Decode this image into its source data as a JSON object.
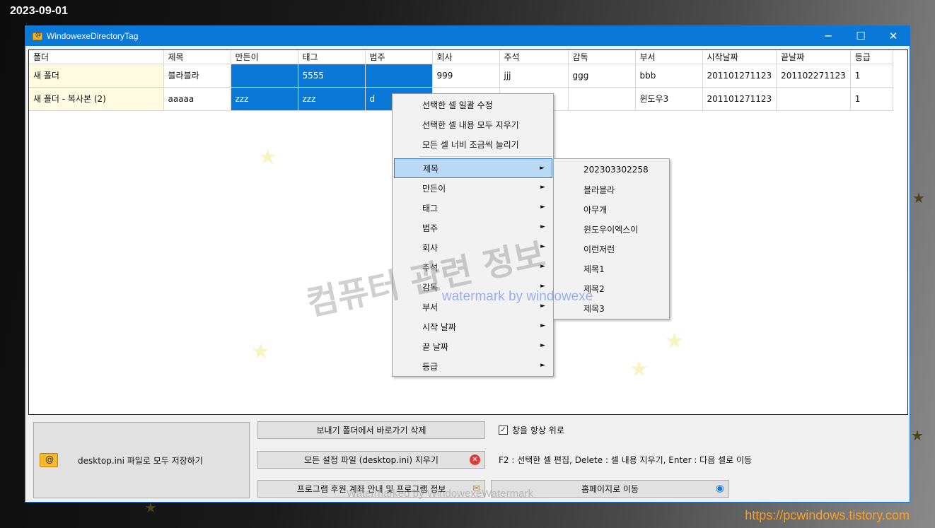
{
  "overlay": {
    "date": "2023-09-01",
    "site_url": "https://pcwindows.tistory.com",
    "watermark_korean": "컴퓨터 관련 정보",
    "watermark_english": "watermark by windowexe",
    "watermark_bottom": "Watermarked by WindowexeWatermark"
  },
  "window": {
    "title": "WindowexeDirectoryTag",
    "minimize": "─",
    "maximize": "☐",
    "close": "✕"
  },
  "grid": {
    "columns": [
      "폴더",
      "제목",
      "만든이",
      "태그",
      "범주",
      "회사",
      "주석",
      "감독",
      "부서",
      "시작날짜",
      "끝날짜",
      "등급"
    ],
    "rows": [
      [
        "새 폴더",
        "블라블라",
        "",
        "5555",
        "",
        "999",
        "jjj",
        "ggg",
        "bbb",
        "201101271123",
        "201102271123",
        "1"
      ],
      [
        "새 폴더 - 복사본 (2)",
        "aaaaa",
        "zzz",
        "zzz",
        "d",
        "",
        "",
        "",
        "윈도우3",
        "201101271123",
        "",
        "1"
      ]
    ]
  },
  "context_menu": {
    "top_items": [
      "선택한 셀 일괄 수정",
      "선택한 셀 내용 모두 지우기",
      "모든 셀 너비 조금씩 늘리기"
    ],
    "sub_items": [
      "제목",
      "만든이",
      "태그",
      "범주",
      "회사",
      "주석",
      "감독",
      "부서",
      "시작 날짜",
      "끝 날짜",
      "등급"
    ],
    "arrow": "►"
  },
  "submenu": {
    "items": [
      "202303302258",
      "블라블라",
      "아무개",
      "윈도우이엑스이",
      "이런저런",
      "제목1",
      "제목2",
      "제목3"
    ]
  },
  "bottom": {
    "save_all": "desktop.ini 파일로 모두 저장하기",
    "delete_shortcut": "보내기 폴더에서 바로가기 삭제",
    "clear_settings": "모든 설정 파일 (desktop.ini) 지우기",
    "donate_info": "프로그램 후원 계좌 안내 및 프로그램 정보",
    "homepage": "홈페이지로 이동",
    "always_on_top": "창을 항상 위로",
    "always_on_top_checked": true,
    "help": "F2 : 선택한 셀 편집, Delete : 셀 내용 지우기, Enter : 다음 셀로 이동"
  }
}
